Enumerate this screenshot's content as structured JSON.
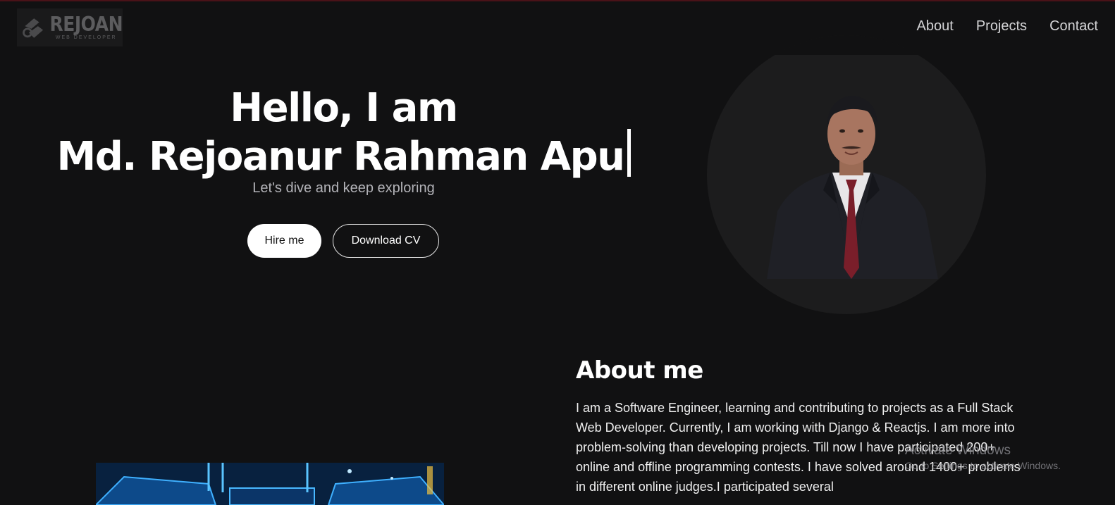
{
  "logo": {
    "name": "REJOAN",
    "subtitle": "WEB DEVELOPER"
  },
  "nav": {
    "items": [
      "About",
      "Projects",
      "Contact"
    ]
  },
  "hero": {
    "greeting": "Hello, I am",
    "name": "Md. Rejoanur Rahman Apu",
    "tagline": "Let's dive and keep exploring",
    "hire_label": "Hire me",
    "cv_label": "Download CV"
  },
  "about": {
    "title": "About me",
    "text": "I am a Software Engineer, learning and contributing to projects as a Full Stack Web Developer. Currently, I am working with Django & Reactjs. I am more into problem-solving than developing projects. Till now I have participated 200+ online and offline programming contests. I have solved around 1400+ problems in different online judges.I participated several"
  },
  "watermark": {
    "title": "Activate Windows",
    "subtitle": "Go to Settings to activate Windows."
  },
  "colors": {
    "background": "#111112",
    "text": "#ffffff",
    "muted": "#b3b3b8"
  }
}
